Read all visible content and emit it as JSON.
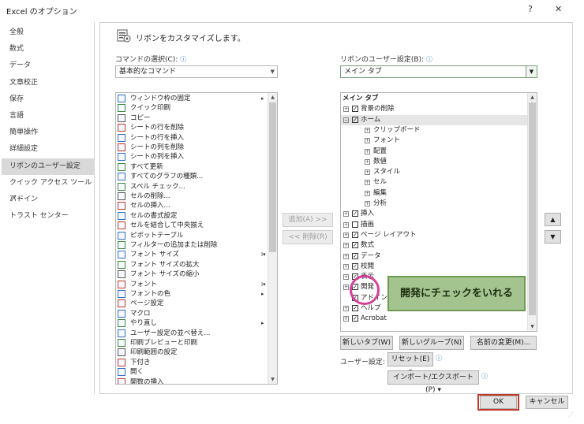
{
  "window": {
    "title": "Excel のオプション",
    "help": "?",
    "close": "✕"
  },
  "nav": {
    "items": [
      {
        "label": "全般",
        "selected": false
      },
      {
        "label": "数式",
        "selected": false
      },
      {
        "label": "データ",
        "selected": false
      },
      {
        "label": "文章校正",
        "selected": false
      },
      {
        "label": "保存",
        "selected": false
      },
      {
        "label": "言語",
        "selected": false
      },
      {
        "label": "簡単操作",
        "selected": false
      },
      {
        "label": "詳細設定",
        "selected": false
      },
      {
        "label": "リボンのユーザー設定",
        "selected": true
      },
      {
        "label": "クイック アクセス ツール バー",
        "selected": false
      },
      {
        "label": "アドイン",
        "selected": false
      },
      {
        "label": "トラスト センター",
        "selected": false
      }
    ]
  },
  "header": {
    "text": "リボンをカスタマイズします。"
  },
  "commands": {
    "label": "コマンドの選択(C):",
    "info": "ⓘ",
    "selected": "基本的なコマンド",
    "items": [
      {
        "label": "ウィンドウ枠の固定",
        "trail": "▸"
      },
      {
        "label": "クイック印刷",
        "trail": ""
      },
      {
        "label": "コピー",
        "trail": ""
      },
      {
        "label": "シートの行を削除",
        "trail": ""
      },
      {
        "label": "シートの行を挿入",
        "trail": ""
      },
      {
        "label": "シートの列を削除",
        "trail": ""
      },
      {
        "label": "シートの列を挿入",
        "trail": ""
      },
      {
        "label": "すべて更新",
        "trail": ""
      },
      {
        "label": "すべてのグラフの種類...",
        "trail": ""
      },
      {
        "label": "スペル チェック...",
        "trail": ""
      },
      {
        "label": "セルの削除...",
        "trail": ""
      },
      {
        "label": "セルの挿入...",
        "trail": ""
      },
      {
        "label": "セルの書式設定",
        "trail": ""
      },
      {
        "label": "セルを結合して中央揃え",
        "trail": ""
      },
      {
        "label": "ピボットテーブル",
        "trail": ""
      },
      {
        "label": "フィルターの追加または削除",
        "trail": ""
      },
      {
        "label": "フォント サイズ",
        "trail": "I▾"
      },
      {
        "label": "フォント サイズの拡大",
        "trail": ""
      },
      {
        "label": "フォント サイズの縮小",
        "trail": ""
      },
      {
        "label": "フォント",
        "trail": "I▾"
      },
      {
        "label": "フォントの色",
        "trail": "▸"
      },
      {
        "label": "ページ設定",
        "trail": ""
      },
      {
        "label": "マクロ",
        "trail": ""
      },
      {
        "label": "やり直し",
        "trail": "▸"
      },
      {
        "label": "ユーザー設定の並べ替え...",
        "trail": ""
      },
      {
        "label": "印刷プレビューと印刷",
        "trail": ""
      },
      {
        "label": "印刷範囲の設定",
        "trail": ""
      },
      {
        "label": "下付き",
        "trail": ""
      },
      {
        "label": "開く",
        "trail": ""
      },
      {
        "label": "関数の挿入",
        "trail": ""
      }
    ]
  },
  "middle": {
    "add": "追加(A) >>",
    "remove": "<< 削除(R)"
  },
  "ribbon": {
    "label": "リボンのユーザー設定(B):",
    "info": "ⓘ",
    "selected": "メイン タブ",
    "tree": [
      {
        "label": "メイン タブ",
        "level": 0,
        "exp": "",
        "checked": null,
        "highlight": false
      },
      {
        "label": "背景の削除",
        "level": 1,
        "exp": "+",
        "checked": true,
        "highlight": false
      },
      {
        "label": "ホーム",
        "level": 1,
        "exp": "−",
        "checked": true,
        "highlight": true
      },
      {
        "label": "クリップボード",
        "level": 2,
        "exp": "+",
        "checked": null,
        "highlight": false
      },
      {
        "label": "フォント",
        "level": 2,
        "exp": "+",
        "checked": null,
        "highlight": false
      },
      {
        "label": "配置",
        "level": 2,
        "exp": "+",
        "checked": null,
        "highlight": false
      },
      {
        "label": "数値",
        "level": 2,
        "exp": "+",
        "checked": null,
        "highlight": false
      },
      {
        "label": "スタイル",
        "level": 2,
        "exp": "+",
        "checked": null,
        "highlight": false
      },
      {
        "label": "セル",
        "level": 2,
        "exp": "+",
        "checked": null,
        "highlight": false
      },
      {
        "label": "編集",
        "level": 2,
        "exp": "+",
        "checked": null,
        "highlight": false
      },
      {
        "label": "分析",
        "level": 2,
        "exp": "+",
        "checked": null,
        "highlight": false
      },
      {
        "label": "挿入",
        "level": 1,
        "exp": "+",
        "checked": true,
        "highlight": false
      },
      {
        "label": "描画",
        "level": 1,
        "exp": "+",
        "checked": false,
        "highlight": false
      },
      {
        "label": "ページ レイアウト",
        "level": 1,
        "exp": "+",
        "checked": true,
        "highlight": false
      },
      {
        "label": "数式",
        "level": 1,
        "exp": "+",
        "checked": true,
        "highlight": false
      },
      {
        "label": "データ",
        "level": 1,
        "exp": "+",
        "checked": true,
        "highlight": false
      },
      {
        "label": "校閲",
        "level": 1,
        "exp": "+",
        "checked": true,
        "highlight": false
      },
      {
        "label": "表示",
        "level": 1,
        "exp": "+",
        "checked": true,
        "highlight": false
      },
      {
        "label": "開発",
        "level": 1,
        "exp": "+",
        "checked": true,
        "highlight": false
      },
      {
        "label": "アドイン",
        "level": 1,
        "exp": "",
        "checked": true,
        "highlight": false
      },
      {
        "label": "ヘルプ",
        "level": 1,
        "exp": "+",
        "checked": true,
        "highlight": false
      },
      {
        "label": "Acrobat",
        "level": 1,
        "exp": "+",
        "checked": true,
        "highlight": false
      }
    ],
    "new_tab": "新しいタブ(W)",
    "new_group": "新しいグループ(N)",
    "rename": "名前の変更(M)...",
    "user_settings_label": "ユーザー設定:",
    "reset": "リセット(E) ▾",
    "import_export": "インポート/エクスポート(P) ▾"
  },
  "move": {
    "up": "▲",
    "down": "▼"
  },
  "annotation": {
    "callout": "開発にチェックをいれる"
  },
  "footer": {
    "ok": "OK",
    "cancel": "キャンセル"
  },
  "colors": {
    "callout_fill": "#a3c48e",
    "ring": "#d63f9a",
    "ok_highlight": "#c0392b"
  }
}
